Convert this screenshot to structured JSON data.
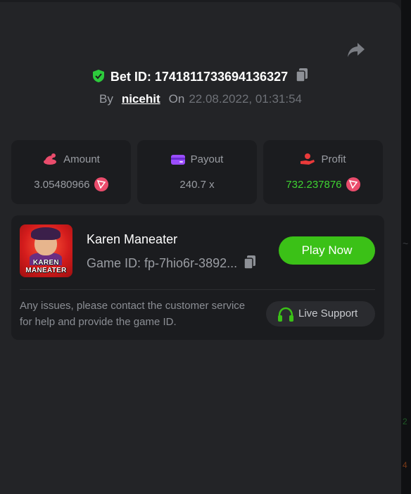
{
  "bet": {
    "id_label": "Bet ID: 1741811733694136327",
    "by_label": "By",
    "username": "nicehit",
    "on_label": "On",
    "datetime": "22.08.2022, 01:31:54"
  },
  "stats": {
    "amount": {
      "label": "Amount",
      "value": "3.05480966",
      "icon": "coin-stack-icon",
      "icon_color": "#ea4c6c"
    },
    "payout": {
      "label": "Payout",
      "value": "240.7 x",
      "icon": "card-icon",
      "icon_color": "#9b4dff"
    },
    "profit": {
      "label": "Profit",
      "value": "732.237876",
      "icon": "hand-coin-icon",
      "icon_color": "#ea3a3a",
      "value_color": "#3fd332"
    }
  },
  "game": {
    "name": "Karen Maneater",
    "id_label": "Game ID: fp-7hio6r-3892...",
    "thumb_line1": "KAREN",
    "thumb_line2": "MANEATER",
    "play_label": "Play Now"
  },
  "support": {
    "message": "Any issues, please contact the customer service for help and provide the game ID.",
    "button_label": "Live Support"
  },
  "colors": {
    "accent_green": "#3bc117",
    "currency_pink": "#ea4c6c",
    "panel_bg": "#232427",
    "card_bg": "#1b1c1f"
  }
}
